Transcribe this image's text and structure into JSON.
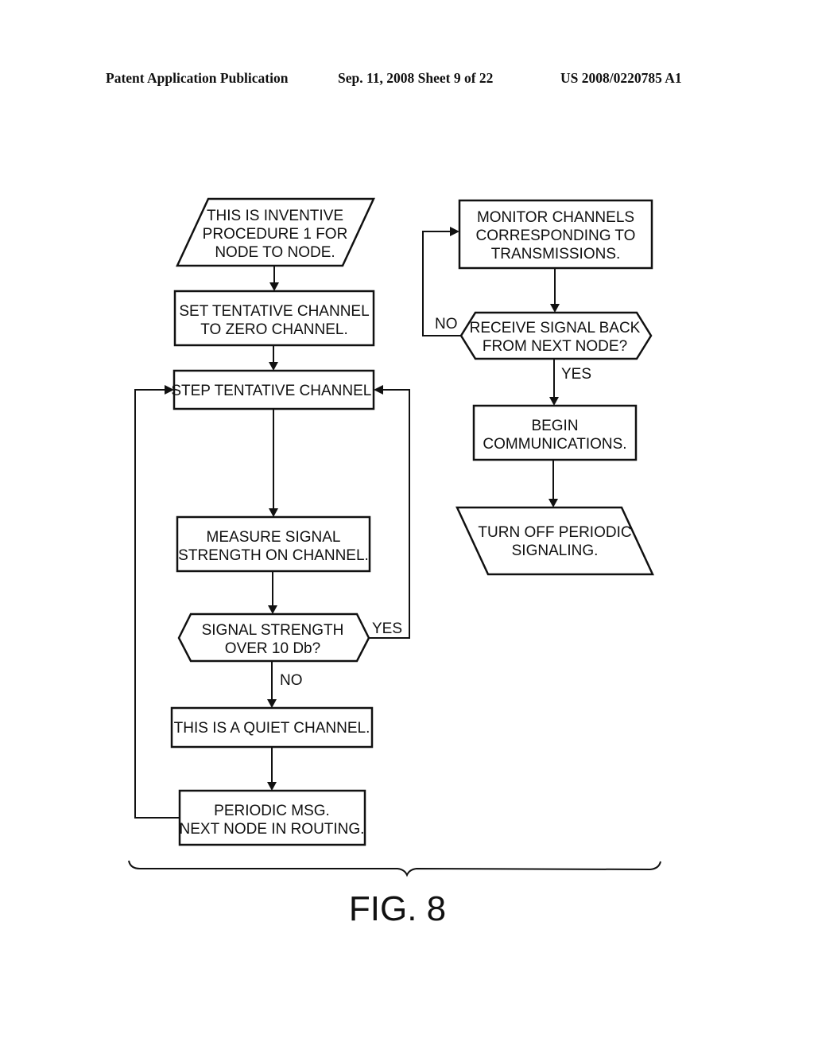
{
  "header": {
    "publication": "Patent Application Publication",
    "date_sheet": "Sep. 11, 2008   Sheet 9 of 22",
    "number": "US 2008/0220785 A1"
  },
  "figure_label": "FIG. 8",
  "nodes": {
    "start": [
      "THIS IS INVENTIVE",
      "PROCEDURE 1 FOR",
      "NODE TO NODE."
    ],
    "set_channel": [
      "SET TENTATIVE CHANNEL",
      "TO ZERO CHANNEL."
    ],
    "step_channel": [
      "STEP TENTATIVE CHANNEL."
    ],
    "measure": [
      "MEASURE SIGNAL",
      "STRENGTH ON CHANNEL."
    ],
    "decision_strength": [
      "SIGNAL STRENGTH",
      "OVER 10 Db?"
    ],
    "quiet": [
      "THIS IS A QUIET CHANNEL."
    ],
    "periodic": [
      "PERIODIC MSG.",
      "NEXT NODE IN ROUTING."
    ],
    "monitor": [
      "MONITOR CHANNELS",
      "CORRESPONDING TO",
      "TRANSMISSIONS."
    ],
    "decision_receive": [
      "RECEIVE SIGNAL BACK",
      "FROM NEXT NODE?"
    ],
    "begin": [
      "BEGIN",
      "COMMUNICATIONS."
    ],
    "turn_off": [
      "TURN OFF PERIODIC",
      "SIGNALING."
    ]
  },
  "edge_labels": {
    "strength_yes": "YES",
    "strength_no": "NO",
    "receive_no": "NO",
    "receive_yes": "YES"
  }
}
